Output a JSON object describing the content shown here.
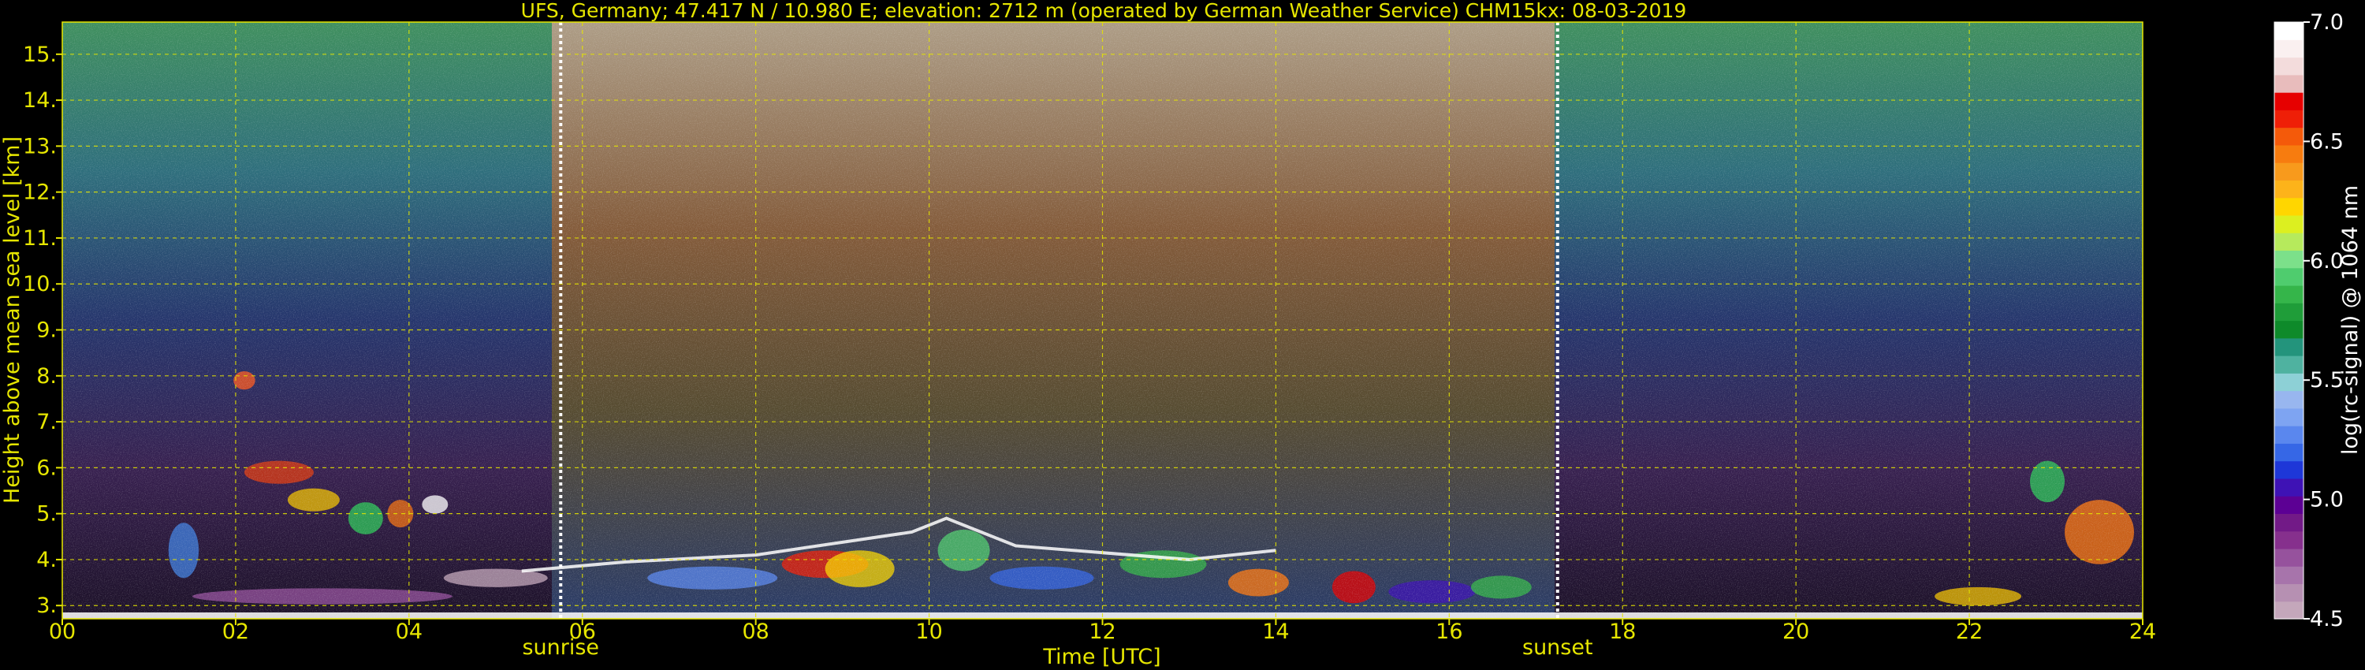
{
  "chart_data": {
    "type": "heatmap",
    "title": "UFS, Germany; 47.417 N / 10.980 E; elevation: 2712 m  (operated by German Weather Service)    CHM15kx: 08-03-2019",
    "xlabel": "Time [UTC]",
    "ylabel": "Height above mean sea level [km]",
    "xlim": [
      0,
      24
    ],
    "ylim": [
      2.712,
      15.7
    ],
    "xticks": [
      "00",
      "02",
      "04",
      "06",
      "08",
      "10",
      "12",
      "14",
      "16",
      "18",
      "20",
      "22",
      "24"
    ],
    "yticks": [
      "3.",
      "4.",
      "5.",
      "6.",
      "7.",
      "8.",
      "9.",
      "10.",
      "11.",
      "12.",
      "13.",
      "14.",
      "15."
    ],
    "grid": true,
    "grid_color": "#e6e600",
    "annotations": [
      {
        "label": "sunrise",
        "x": 5.75
      },
      {
        "label": "sunset",
        "x": 17.25
      }
    ],
    "colorbar": {
      "label": "log(rc-signal) @ 1064 nm",
      "range": [
        4.5,
        7.0
      ],
      "ticks": [
        "4.5",
        "5.0",
        "5.5",
        "6.0",
        "6.5",
        "7.0"
      ],
      "colors": [
        "#c4a7bb",
        "#b690b2",
        "#a774ab",
        "#96529d",
        "#86308d",
        "#721a87",
        "#5c0094",
        "#3e12b5",
        "#1e37d8",
        "#3667e6",
        "#5a87ee",
        "#7ea4f2",
        "#98b6ef",
        "#8dd0d6",
        "#4fb2a0",
        "#23947c",
        "#0e8a2a",
        "#1f9d39",
        "#35b54a",
        "#4fcc6e",
        "#7ce08a",
        "#b6ea5c",
        "#dcef20",
        "#ffd600",
        "#fdb31a",
        "#f89a1c",
        "#f77c0f",
        "#f45a0a",
        "#ef1f07",
        "#e60000",
        "#e8bcbc",
        "#f3dcdc",
        "#faf0f0",
        "#ffffff"
      ]
    }
  }
}
